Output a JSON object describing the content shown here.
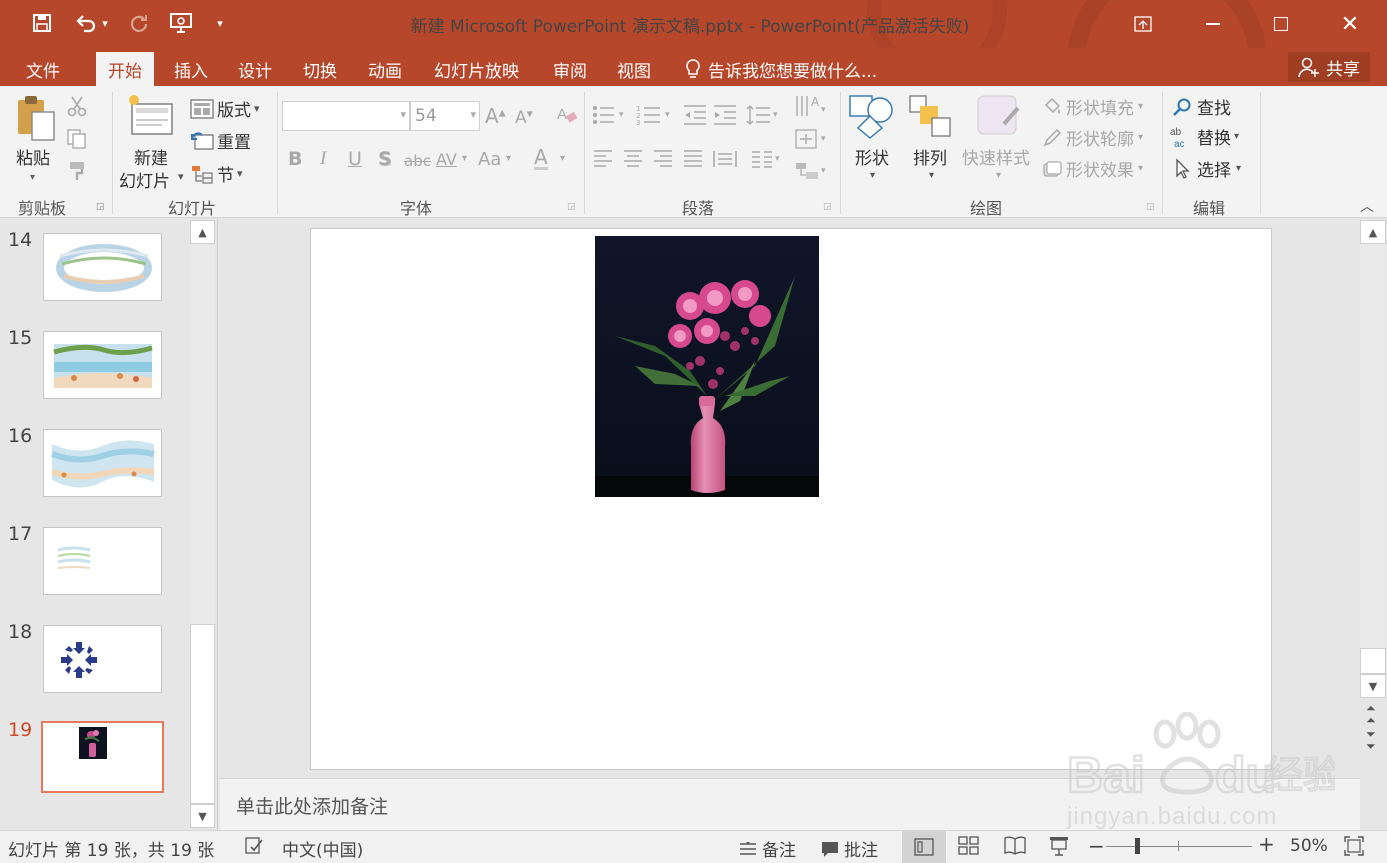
{
  "window": {
    "title": "新建 Microsoft PowerPoint 演示文稿.pptx - PowerPoint(产品激活失败)"
  },
  "menu": {
    "tabs": [
      "文件",
      "开始",
      "插入",
      "设计",
      "切换",
      "动画",
      "幻灯片放映",
      "审阅",
      "视图"
    ],
    "active_tab": "开始",
    "tell_me": "告诉我您想要做什么...",
    "share": "共享"
  },
  "ribbon": {
    "clipboard": {
      "paste": "粘贴",
      "label": "剪贴板"
    },
    "slides": {
      "new_slide_1": "新建",
      "new_slide_2": "幻灯片",
      "layout": "版式",
      "reset": "重置",
      "section": "节",
      "label": "幻灯片"
    },
    "font": {
      "font_name": "",
      "font_size": "54",
      "label": "字体",
      "bold": "B",
      "italic": "I",
      "underline": "U",
      "shadow": "S",
      "strike": "abc",
      "spacing": "AV",
      "case": "Aa",
      "color": "A"
    },
    "paragraph": {
      "label": "段落"
    },
    "drawing": {
      "shapes": "形状",
      "arrange": "排列",
      "quick_styles": "快速样式",
      "fill": "形状填充",
      "outline": "形状轮廓",
      "effects": "形状效果",
      "label": "绘图"
    },
    "editing": {
      "find": "查找",
      "replace": "替换",
      "select": "选择",
      "label": "编辑"
    }
  },
  "thumbnails": [
    {
      "num": "14",
      "kind": "ring"
    },
    {
      "num": "15",
      "kind": "beach"
    },
    {
      "num": "16",
      "kind": "wave"
    },
    {
      "num": "17",
      "kind": "small"
    },
    {
      "num": "18",
      "kind": "arrows"
    },
    {
      "num": "19",
      "kind": "flower",
      "active": true
    }
  ],
  "notes_placeholder": "单击此处添加备注",
  "status": {
    "slide_info": "幻灯片 第 19 张，共 19 张",
    "language": "中文(中国)",
    "notes": "备注",
    "comments": "批注",
    "zoom": "50%"
  },
  "watermark": {
    "brand": "Baidu经验",
    "url": "jingyan.baidu.com"
  },
  "colors": {
    "accent": "#b7472a",
    "active_thumb": "#e8775b"
  }
}
